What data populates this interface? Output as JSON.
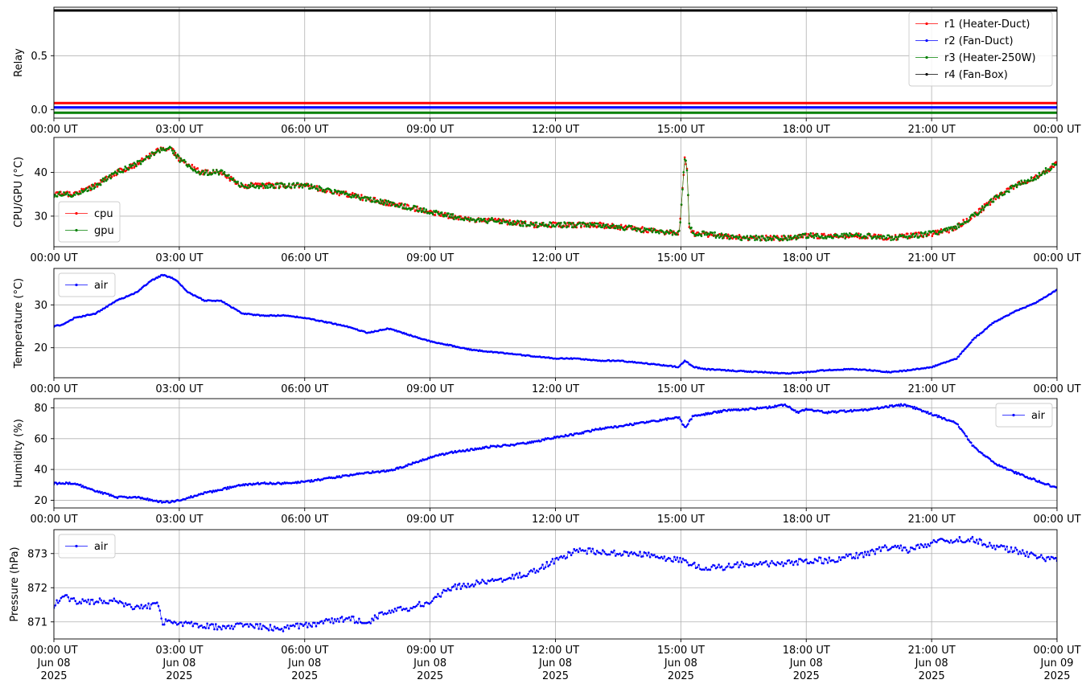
{
  "figure": {
    "x_tick_labels": [
      "00:00 UT",
      "03:00 UT",
      "06:00 UT",
      "09:00 UT",
      "12:00 UT",
      "15:00 UT",
      "18:00 UT",
      "21:00 UT",
      "00:00 UT"
    ],
    "bottom_date_labels": [
      [
        "Jun 08",
        "2025"
      ],
      [
        "Jun 08",
        "2025"
      ],
      [
        "Jun 08",
        "2025"
      ],
      [
        "Jun 08",
        "2025"
      ],
      [
        "Jun 08",
        "2025"
      ],
      [
        "Jun 08",
        "2025"
      ],
      [
        "Jun 08",
        "2025"
      ],
      [
        "Jun 08",
        "2025"
      ],
      [
        "Jun 09",
        "2025"
      ]
    ],
    "x_range_hours": [
      0,
      24
    ],
    "grid": true
  },
  "chart_data": [
    {
      "id": "relay",
      "type": "line",
      "ylabel": "Relay",
      "ylim": [
        -0.08,
        0.95
      ],
      "yticks": [
        0.0,
        0.5
      ],
      "ytick_labels": [
        "0.0",
        "0.5"
      ],
      "legend_position": "top-right",
      "series": [
        {
          "name": "r1 (Heater-Duct)",
          "color": "#ff0000",
          "constant": 0.06
        },
        {
          "name": "r2 (Fan-Duct)",
          "color": "#0000ff",
          "constant": 0.02
        },
        {
          "name": "r3 (Heater-250W)",
          "color": "#008000",
          "constant": -0.03
        },
        {
          "name": "r4 (Fan-Box)",
          "color": "#000000",
          "constant": 0.92
        }
      ]
    },
    {
      "id": "cpu_gpu",
      "type": "scatter",
      "ylabel": "CPU/GPU (°C)",
      "ylim": [
        23,
        48
      ],
      "yticks": [
        30,
        40
      ],
      "ytick_labels": [
        "30",
        "40"
      ],
      "legend_position": "lower-left",
      "series": [
        {
          "name": "cpu",
          "color": "#ff0000",
          "x": [
            0,
            0.5,
            1,
            1.5,
            2,
            2.5,
            2.8,
            3,
            3.5,
            4,
            4.5,
            5,
            5.5,
            6,
            6.5,
            7,
            7.5,
            8,
            8.5,
            9,
            9.5,
            10,
            10.5,
            11,
            11.5,
            12,
            12.5,
            13,
            13.5,
            14,
            14.5,
            14.95,
            15,
            15.05,
            15.1,
            15.15,
            15.2,
            15.3,
            15.5,
            16,
            16.5,
            17,
            17.5,
            18,
            18.5,
            19,
            19.5,
            20,
            20.5,
            21,
            21.5,
            22,
            22.5,
            23,
            23.5,
            24
          ],
          "y": [
            35,
            35,
            37,
            40,
            42,
            45,
            45.5,
            43,
            40,
            40,
            37,
            37,
            37,
            37,
            36,
            35,
            34,
            33,
            32,
            31,
            30,
            29,
            29,
            28.5,
            28,
            28,
            28,
            28,
            27.5,
            27,
            26.5,
            26,
            30,
            38,
            44,
            40,
            28,
            26,
            26,
            25.5,
            25,
            25,
            25,
            25.5,
            25.5,
            25.5,
            25.5,
            25,
            25.5,
            26,
            27,
            30,
            34,
            37,
            39,
            42
          ]
        },
        {
          "name": "gpu",
          "color": "#008000",
          "x": [
            0,
            0.5,
            1,
            1.5,
            2,
            2.5,
            2.8,
            3,
            3.5,
            4,
            4.5,
            5,
            5.5,
            6,
            6.5,
            7,
            7.5,
            8,
            8.5,
            9,
            9.5,
            10,
            10.5,
            11,
            11.5,
            12,
            12.5,
            13,
            13.5,
            14,
            14.5,
            14.95,
            15,
            15.05,
            15.1,
            15.15,
            15.2,
            15.3,
            15.5,
            16,
            16.5,
            17,
            17.5,
            18,
            18.5,
            19,
            19.5,
            20,
            20.5,
            21,
            21.5,
            22,
            22.5,
            23,
            23.5,
            24
          ],
          "y": [
            35,
            35,
            37,
            40,
            42,
            45,
            45.5,
            43,
            40,
            40,
            37,
            37,
            37,
            37,
            36,
            35,
            34,
            33,
            32,
            31,
            30,
            29,
            29,
            28.5,
            28,
            28,
            28,
            28,
            27.5,
            27,
            26.5,
            26,
            30,
            38,
            44,
            40,
            28,
            26,
            26,
            25.5,
            25,
            25,
            25,
            25.5,
            25.5,
            25.5,
            25.5,
            25,
            25.5,
            26,
            27,
            30,
            34,
            37,
            39,
            42
          ]
        }
      ]
    },
    {
      "id": "temperature",
      "type": "scatter",
      "ylabel": "Temperature (°C)",
      "ylim": [
        13,
        38.5
      ],
      "yticks": [
        20,
        30
      ],
      "ytick_labels": [
        "20",
        "30"
      ],
      "legend_position": "top-left",
      "series": [
        {
          "name": "air",
          "color": "#0000ff",
          "x": [
            0,
            0.25,
            0.5,
            1,
            1.5,
            2,
            2.3,
            2.6,
            2.9,
            3.2,
            3.6,
            4,
            4.5,
            5,
            5.5,
            6,
            6.5,
            7,
            7.5,
            8,
            8.5,
            9,
            9.5,
            10,
            10.5,
            11,
            11.5,
            12,
            12.5,
            13,
            13.5,
            14,
            14.5,
            14.95,
            15.1,
            15.3,
            15.6,
            16,
            16.5,
            17,
            17.5,
            18,
            18.5,
            19,
            19.5,
            20,
            20.5,
            21,
            21.3,
            21.6,
            22,
            22.5,
            23,
            23.5,
            24
          ],
          "y": [
            25,
            25.5,
            27,
            28,
            31,
            33,
            35.5,
            37,
            36,
            33,
            31,
            31,
            28,
            27.5,
            27.5,
            27,
            26,
            25,
            23.5,
            24.5,
            23,
            21.5,
            20.5,
            19.5,
            19,
            18.5,
            18,
            17.5,
            17.5,
            17,
            17,
            16.5,
            16,
            15.5,
            17,
            15.5,
            15,
            14.8,
            14.5,
            14.3,
            14,
            14.3,
            14.8,
            15,
            14.8,
            14.3,
            14.8,
            15.5,
            16.5,
            17.5,
            22,
            26,
            28.5,
            30.5,
            33.5
          ]
        }
      ]
    },
    {
      "id": "humidity",
      "type": "scatter",
      "ylabel": "Humidity (%)",
      "ylim": [
        15,
        86
      ],
      "yticks": [
        20,
        40,
        60,
        80
      ],
      "ytick_labels": [
        "20",
        "40",
        "60",
        "80"
      ],
      "legend_position": "top-right",
      "series": [
        {
          "name": "air",
          "color": "#0000ff",
          "x": [
            0,
            0.5,
            1,
            1.5,
            2,
            2.5,
            2.8,
            3,
            3.5,
            4,
            4.5,
            5,
            5.5,
            6,
            6.5,
            7,
            7.5,
            8,
            8.5,
            9,
            9.5,
            10,
            10.5,
            11,
            11.5,
            12,
            12.5,
            13,
            13.5,
            14,
            14.5,
            14.95,
            15.1,
            15.3,
            15.6,
            16,
            16.5,
            17,
            17.5,
            17.8,
            18,
            18.5,
            19,
            19.5,
            20,
            20.3,
            20.6,
            21,
            21.3,
            21.6,
            22,
            22.5,
            23,
            23.5,
            24
          ],
          "y": [
            31,
            31,
            26,
            22,
            22,
            19,
            19,
            20,
            24,
            27,
            30,
            31,
            31,
            32,
            34,
            36,
            38,
            39,
            43,
            48,
            51,
            53,
            55,
            56,
            58,
            61,
            63,
            66,
            68,
            70,
            72,
            74,
            67,
            75,
            76,
            78,
            79,
            80,
            82,
            77,
            79,
            77,
            78,
            79,
            81,
            82,
            80,
            76,
            73,
            70,
            55,
            44,
            38,
            33,
            28
          ]
        }
      ]
    },
    {
      "id": "pressure",
      "type": "scatter",
      "ylabel": "Pressure (hPa)",
      "ylim": [
        870.5,
        873.7
      ],
      "yticks": [
        871,
        872,
        873
      ],
      "ytick_labels": [
        "871",
        "872",
        "873"
      ],
      "legend_position": "top-left",
      "series": [
        {
          "name": "air",
          "color": "#0000ff",
          "x": [
            0,
            0.25,
            0.5,
            1,
            1.5,
            2,
            2.5,
            2.6,
            3,
            3.5,
            4,
            4.5,
            5,
            5.5,
            6,
            6.5,
            7,
            7.5,
            8,
            8.5,
            9,
            9.5,
            10,
            10.5,
            11,
            11.5,
            12,
            12.5,
            13,
            13.5,
            14,
            14.5,
            15,
            15.5,
            16,
            16.5,
            17,
            17.5,
            18,
            18.5,
            19,
            19.5,
            20,
            20.5,
            21,
            21.5,
            22,
            22.5,
            23,
            23.5,
            24
          ],
          "y": [
            871.5,
            871.8,
            871.6,
            871.6,
            871.6,
            871.4,
            871.5,
            871.0,
            870.95,
            870.9,
            870.85,
            870.9,
            870.85,
            870.8,
            870.9,
            871.0,
            871.1,
            871.0,
            871.3,
            871.4,
            871.6,
            872.0,
            872.1,
            872.2,
            872.3,
            872.5,
            872.8,
            873.1,
            873.05,
            873.0,
            873.0,
            872.9,
            872.8,
            872.6,
            872.6,
            872.7,
            872.7,
            872.7,
            872.8,
            872.8,
            872.9,
            873.0,
            873.2,
            873.1,
            873.3,
            873.4,
            873.4,
            873.2,
            873.1,
            872.9,
            872.8
          ]
        }
      ]
    }
  ]
}
